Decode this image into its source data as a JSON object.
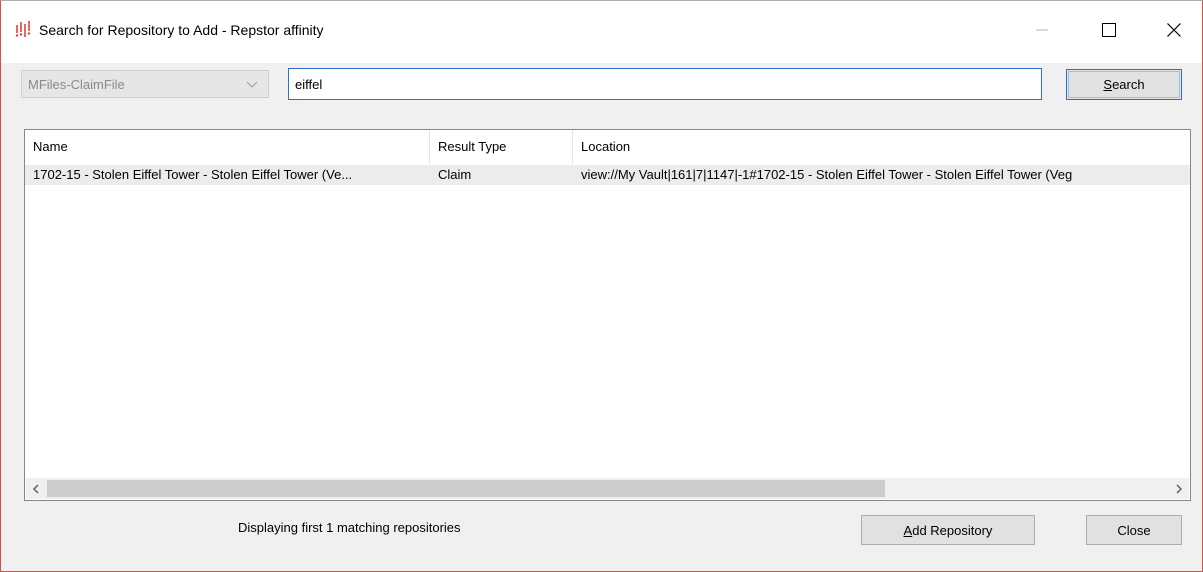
{
  "window": {
    "title": "Search for Repository to Add - Repstor affinity",
    "min_label": "—",
    "max_label": "☐",
    "close_label": "✕"
  },
  "search": {
    "repository_selected": "MFiles-ClaimFile",
    "query": "eiffel",
    "button_label_underlined": "S",
    "button_label_rest": "earch"
  },
  "results": {
    "columns": [
      "Name",
      "Result Type",
      "Location"
    ],
    "rows": [
      {
        "name": "1702-15 - Stolen Eiffel Tower - Stolen Eiffel Tower (Ve...",
        "type": "Claim",
        "location": "view://My Vault|161|7|1147|-1#1702-15 - Stolen Eiffel Tower - Stolen Eiffel Tower (Veg"
      }
    ]
  },
  "footer": {
    "status_text": "Displaying first 1 matching repositories",
    "add_label_underlined": "A",
    "add_label_rest": "dd Repository",
    "close_label": "Close"
  },
  "icons": {
    "app": "repstor-logo-icon",
    "combo_arrow": "chevron-down-icon",
    "scroll_left": "chevron-left-icon",
    "scroll_right": "chevron-right-icon"
  },
  "colors": {
    "accent": "#2b72c8",
    "logo": "#e0413c"
  }
}
